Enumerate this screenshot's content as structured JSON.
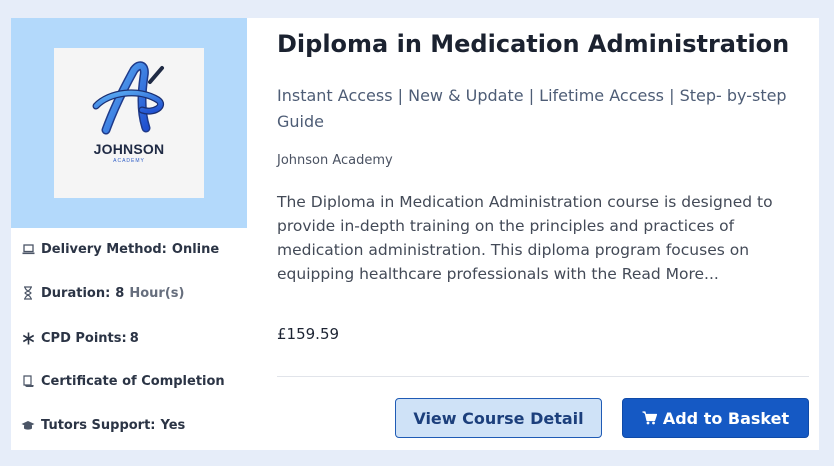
{
  "course": {
    "title": "Diploma in Medication Administration",
    "features": "Instant Access | New & Update | Lifetime Access | Step- by-step Guide",
    "provider": "Johnson Academy",
    "description": "The Diploma in Medication Administration course is designed to provide in-depth training on the principles and practices of medication administration. This diploma program focuses on equipping healthcare professionals with the Read More...",
    "price": "£159.59"
  },
  "logo": {
    "main": "JOHNSON",
    "sub": "ACADEMY"
  },
  "meta": {
    "delivery_label": "Delivery Method:",
    "delivery_value": "Online",
    "duration_label": "Duration:",
    "duration_value": "8",
    "duration_unit": "Hour(s)",
    "cpd_label": "CPD Points:",
    "cpd_value": "8",
    "certificate_label": "Certificate of Completion",
    "tutors_label": "Tutors Support:",
    "tutors_value": "Yes"
  },
  "actions": {
    "detail_label": "View Course Detail",
    "basket_label": "Add to Basket"
  },
  "colors": {
    "page_bg": "#e6edf9",
    "thumb_bg": "#b3d9fb",
    "primary": "#1559c4",
    "detail_bg": "#cfe2f7"
  },
  "icons": [
    "laptop-icon",
    "hourglass-icon",
    "asterisk-icon",
    "certificate-icon",
    "graduation-cap-icon",
    "cart-icon"
  ]
}
